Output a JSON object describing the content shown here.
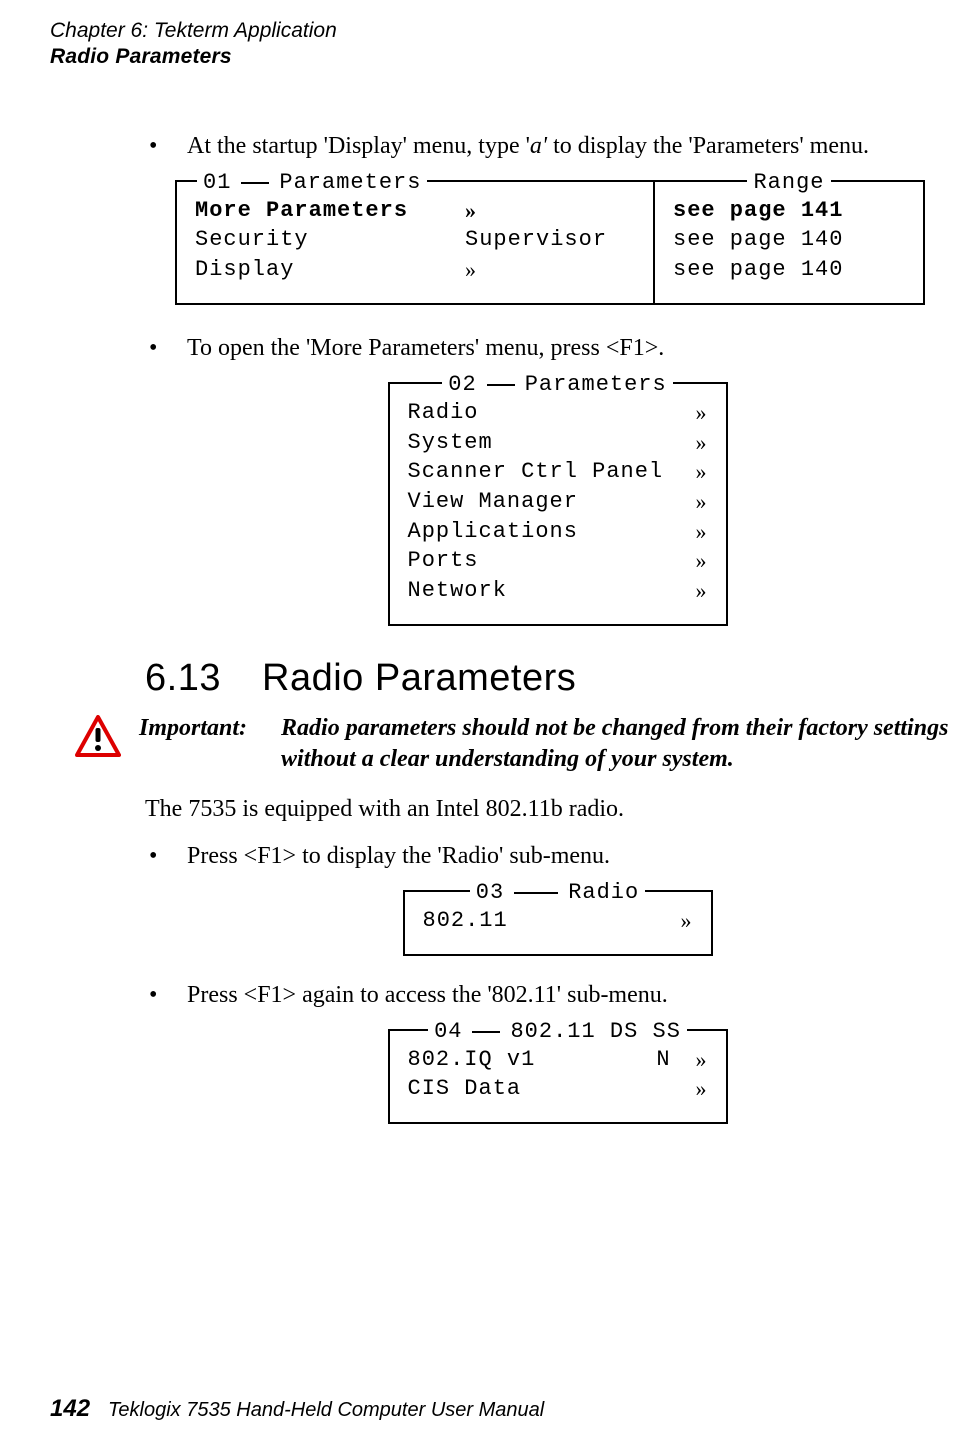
{
  "header": {
    "line1": "Chapter 6: Tekterm Application",
    "line2": "Radio Parameters"
  },
  "bullets": {
    "b1_pre": "At the startup 'Display' menu, type '",
    "b1_em": "a'",
    "b1_post": " to display the 'Parameters' menu.",
    "b2": "To open the 'More Parameters' menu, press <F1>.",
    "b3": "Press <F1> to display the 'Radio' sub-menu.",
    "b4": "Press <F1> again to access the '802.11' sub-menu."
  },
  "menu01": {
    "num": "01",
    "title": "Parameters",
    "range_title": "Range",
    "rows": [
      {
        "name": "More Parameters",
        "val": "»",
        "range": "see page 141",
        "bold": true
      },
      {
        "name": "Security",
        "val": "Supervisor",
        "range": "see page 140",
        "bold": false
      },
      {
        "name": "Display",
        "val": "»",
        "range": "see page 140",
        "bold": false
      }
    ]
  },
  "menu02": {
    "num": "02",
    "title": "Parameters",
    "items": [
      "Radio",
      "System",
      "Scanner Ctrl Panel",
      "View Manager",
      "Applications",
      "Ports",
      "Network"
    ],
    "arrow": "»"
  },
  "section": {
    "num": "6.13",
    "title": "Radio Parameters"
  },
  "important": {
    "label": "Important:",
    "text": "Radio parameters should not be changed from their factory settings without a clear understanding of your system."
  },
  "para1": "The 7535 is equipped with an Intel 802.11b radio.",
  "menu03": {
    "num": "03",
    "title": "Radio",
    "item": "802.11",
    "arrow": "»"
  },
  "menu04": {
    "num": "04",
    "title": "802.11 DS SS",
    "rows": [
      {
        "name": "802.IQ v1",
        "mid": "N",
        "arrow": "»"
      },
      {
        "name": "CIS Data",
        "mid": "",
        "arrow": "»"
      }
    ]
  },
  "footer": {
    "page": "142",
    "book": "Teklogix 7535 Hand-Held Computer User Manual"
  }
}
